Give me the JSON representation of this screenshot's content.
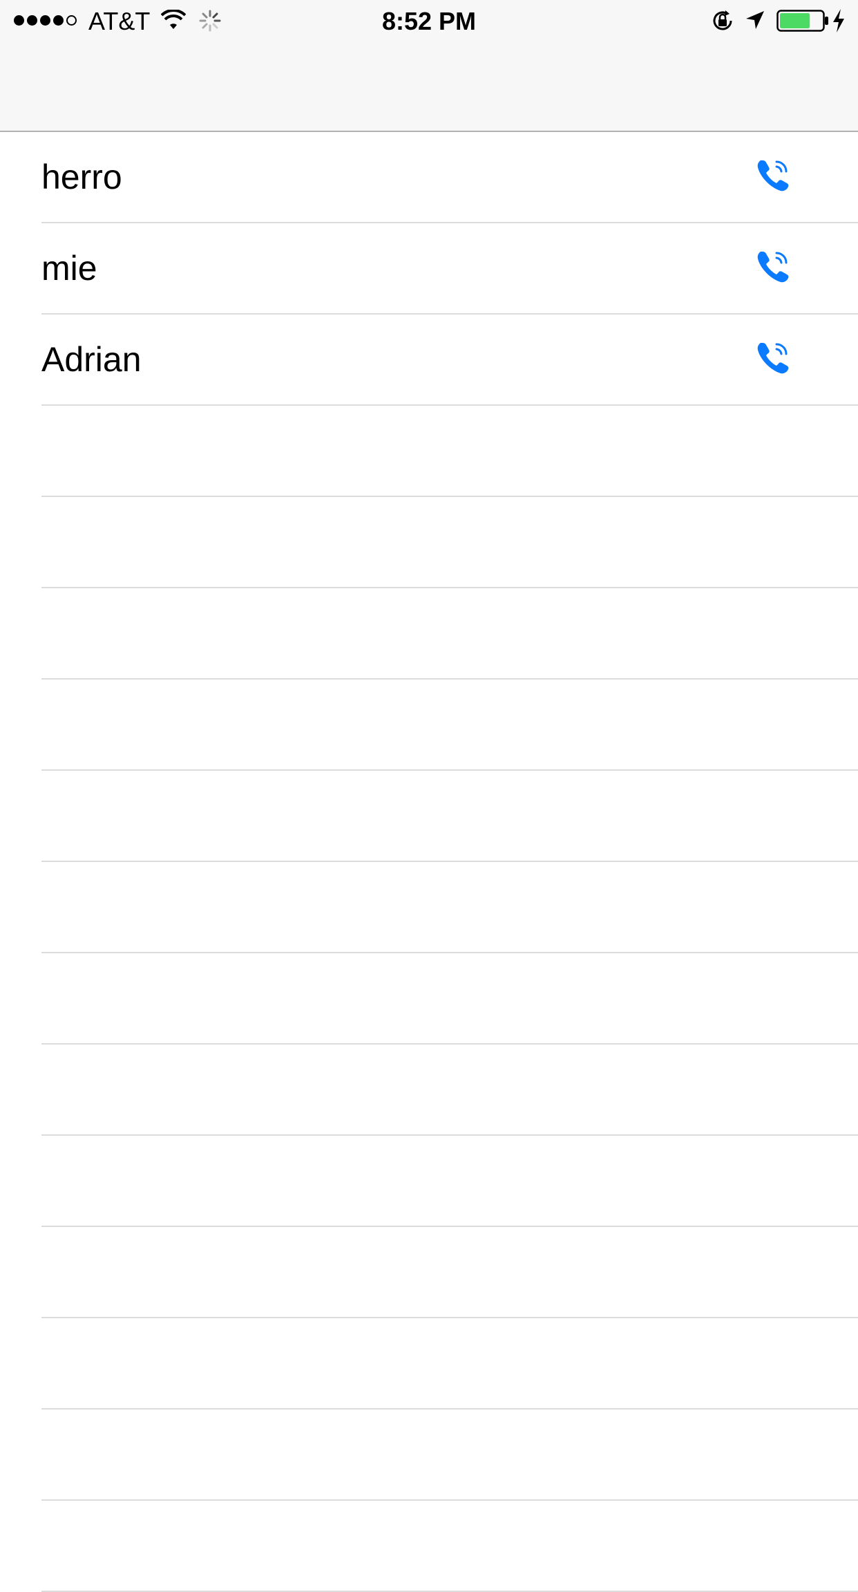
{
  "status_bar": {
    "signal_bars_filled": 4,
    "signal_bars_total": 5,
    "carrier": "AT&T",
    "time": "8:52 PM",
    "icons": [
      "wifi-icon",
      "activity-spinner-icon",
      "rotation-lock-icon",
      "location-arrow-icon",
      "battery-icon",
      "charging-bolt-icon"
    ],
    "battery_level": 0.72,
    "battery_fill_color": "#4cd964"
  },
  "accent_color": "#0a7aff",
  "contacts": [
    {
      "name": "herro",
      "action_icon": "phone-call-icon"
    },
    {
      "name": "mie",
      "action_icon": "phone-call-icon"
    },
    {
      "name": "Adrian",
      "action_icon": "phone-call-icon"
    }
  ],
  "empty_rows": 13
}
